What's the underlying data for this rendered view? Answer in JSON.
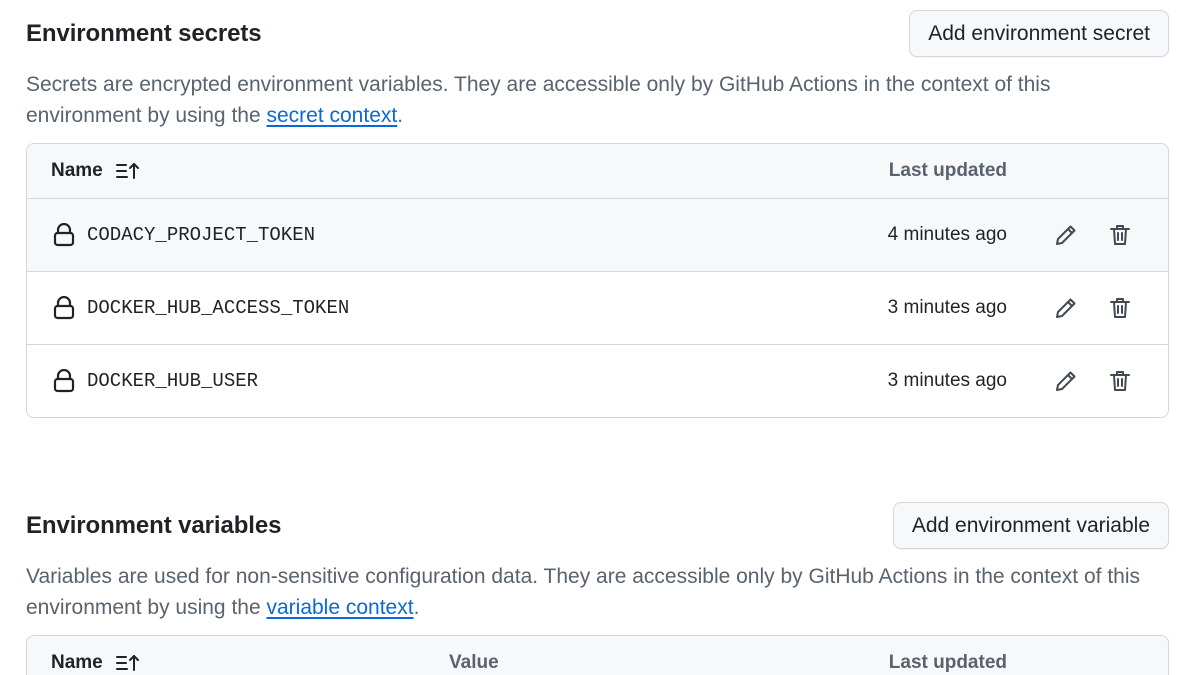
{
  "secrets": {
    "title": "Environment secrets",
    "add_button": "Add environment secret",
    "description_prefix": "Secrets are encrypted environment variables. They are accessible only by GitHub Actions in the context of this environment by using the ",
    "description_link": "secret context",
    "description_suffix": ".",
    "table": {
      "col_name": "Name",
      "col_updated": "Last updated",
      "rows": [
        {
          "name": "CODACY_PROJECT_TOKEN",
          "updated": "4 minutes ago",
          "icon": "lock-icon"
        },
        {
          "name": "DOCKER_HUB_ACCESS_TOKEN",
          "updated": "3 minutes ago",
          "icon": "lock-icon"
        },
        {
          "name": "DOCKER_HUB_USER",
          "updated": "3 minutes ago",
          "icon": "lock-icon"
        }
      ]
    }
  },
  "variables": {
    "title": "Environment variables",
    "add_button": "Add environment variable",
    "description_prefix": "Variables are used for non-sensitive configuration data. They are accessible only by GitHub Actions in the context of this environment by using the ",
    "description_link": "variable context",
    "description_suffix": ".",
    "table": {
      "col_name": "Name",
      "col_value": "Value",
      "col_updated": "Last updated"
    }
  },
  "colors": {
    "link": "#0969da",
    "border": "#d0d7de",
    "header_bg": "#f6f8fa",
    "muted_text": "#59636e"
  }
}
